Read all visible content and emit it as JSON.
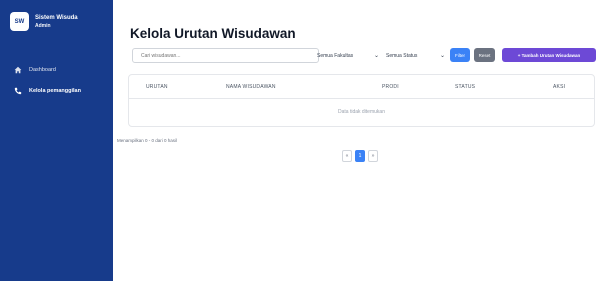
{
  "sidebar": {
    "logo": "SW",
    "title": "Sistem Wisuda",
    "subtitle": "Admin",
    "items": [
      {
        "label": "Dashboard",
        "icon": "home-icon"
      },
      {
        "label": "Kelola pemanggilan",
        "icon": "phone-icon"
      }
    ]
  },
  "main": {
    "title": "Kelola Urutan Wisudawan",
    "search_placeholder": "Cari wisudawan...",
    "filter_fakultas": "Semua Fakultas",
    "filter_status": "Semua Status",
    "filter_button": "Filter",
    "reset_button": "Reset",
    "add_button": "+ Tambah Urutan Wisudawan"
  },
  "table": {
    "columns": [
      "URUTAN",
      "NAMA WISUDAWAN",
      "PRODI",
      "STATUS",
      "AKSI"
    ],
    "empty_text": "Data tidak ditemukan",
    "showing": "Menampilkan 0 - 0 dari 0 hasil"
  },
  "pagination": {
    "prev": "«",
    "current": "1",
    "next": "»"
  },
  "colors": {
    "sidebar": "#173b8b",
    "primary": "#3b82f6",
    "accent": "#6d49d6",
    "reset": "#6b7280"
  }
}
